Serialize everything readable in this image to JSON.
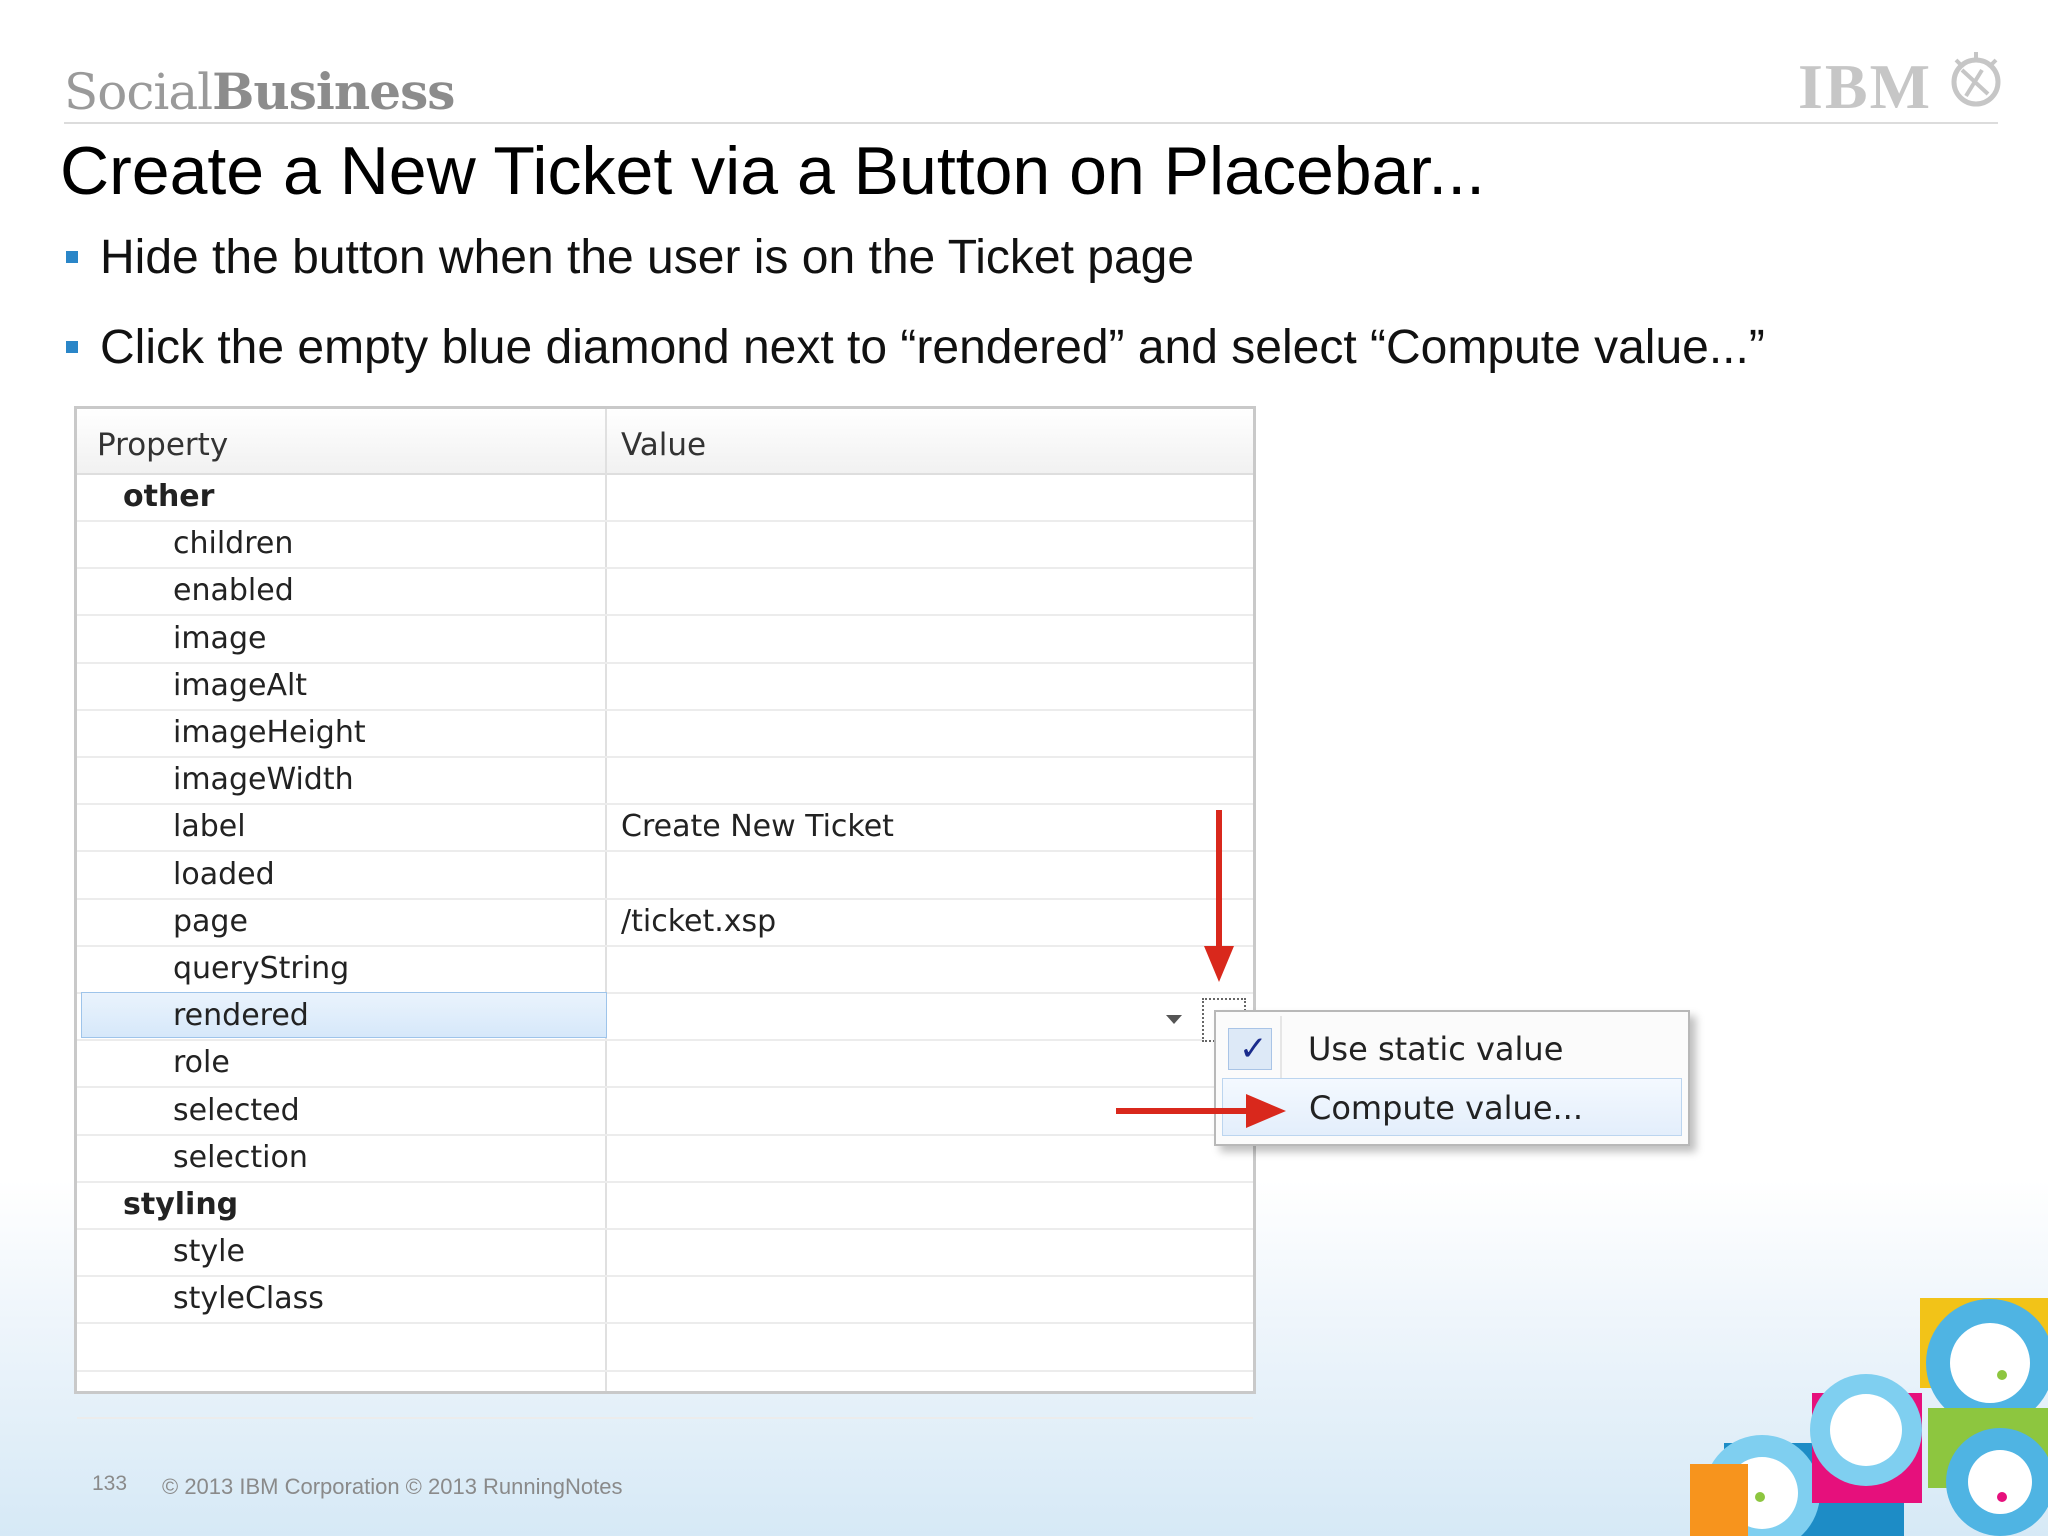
{
  "brand": {
    "light": "Social",
    "bold": "Business"
  },
  "ibm_logo": "IBM",
  "title": "Create a New Ticket via a Button on Placebar...",
  "bullets": [
    "Hide the button when the user is on the Ticket page",
    "Click the empty blue diamond next to “rendered” and select “Compute value...”"
  ],
  "properties_panel": {
    "column_property": "Property",
    "column_value": "Value",
    "rows": [
      {
        "name": "other",
        "value": "",
        "group": true
      },
      {
        "name": "children",
        "value": ""
      },
      {
        "name": "enabled",
        "value": ""
      },
      {
        "name": "image",
        "value": ""
      },
      {
        "name": "imageAlt",
        "value": ""
      },
      {
        "name": "imageHeight",
        "value": ""
      },
      {
        "name": "imageWidth",
        "value": ""
      },
      {
        "name": "label",
        "value": "Create New Ticket"
      },
      {
        "name": "loaded",
        "value": ""
      },
      {
        "name": "page",
        "value": "/ticket.xsp"
      },
      {
        "name": "queryString",
        "value": ""
      },
      {
        "name": "rendered",
        "value": "",
        "selected": true
      },
      {
        "name": "role",
        "value": ""
      },
      {
        "name": "selected",
        "value": ""
      },
      {
        "name": "selection",
        "value": ""
      },
      {
        "name": "styling",
        "value": "",
        "group": true
      },
      {
        "name": "style",
        "value": ""
      },
      {
        "name": "styleClass",
        "value": ""
      }
    ]
  },
  "context_menu": {
    "items": [
      {
        "label": "Use static value",
        "checked": true
      },
      {
        "label": "Compute value...",
        "checked": false
      }
    ]
  },
  "annotation_color": "#d9281c",
  "accent_color": "#2a86c8",
  "footer": {
    "page_number": "133",
    "copyright": "© 2013 IBM Corporation  © 2013 RunningNotes"
  }
}
